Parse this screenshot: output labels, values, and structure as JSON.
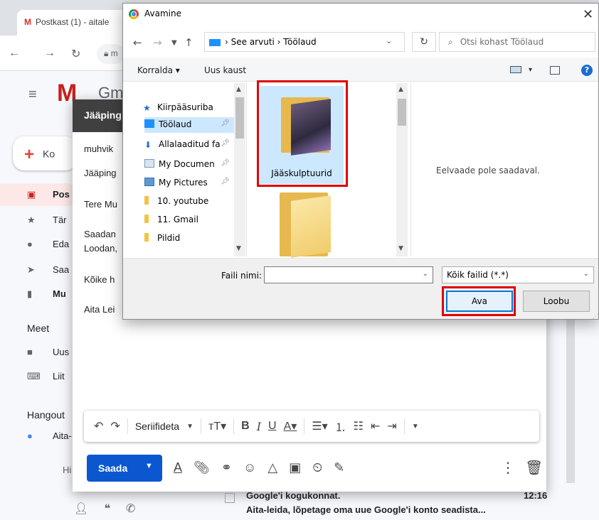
{
  "browser": {
    "tab_title": "Postkast (1) - aitale",
    "address_fragment": "m"
  },
  "gmail": {
    "logo_letters": "Gm",
    "compose_button": "Ko",
    "nav": [
      {
        "label": "Pos",
        "icon": "inbox-icon"
      },
      {
        "label": "Tär",
        "icon": "star-icon"
      },
      {
        "label": "Eda",
        "icon": "clock-icon"
      },
      {
        "label": "Saa",
        "icon": "send-icon"
      },
      {
        "label": "Mu",
        "icon": "draft-icon"
      }
    ],
    "meet_title": "Meet",
    "meet_items": [
      "Uus",
      "Liit"
    ],
    "hangouts_title": "Hangout",
    "hangouts_user": "Aita-",
    "hangouts_hint": "Hi",
    "bg_email": {
      "sender": "Google'i kogukonnat.",
      "subject": "Aita-leida, lõpetage oma uue Google'i konto seadista...",
      "time": "12:16"
    }
  },
  "compose": {
    "header": "Jääping",
    "to": "muhvik",
    "subject": "Jääping",
    "body_lines": [
      "Tere Mu",
      "Saadan",
      "Loodan,",
      "Kõike h",
      "Aita Lei"
    ],
    "font_name": "Seriifideta",
    "send_label": "Saada"
  },
  "dialog": {
    "title": "Avamine",
    "breadcrumb": [
      "See arvuti",
      "Töölaud"
    ],
    "search_placeholder": "Otsi kohast Töölaud",
    "organize": "Korralda",
    "new_folder": "Uus kaust",
    "tree": [
      {
        "label": "Kiirpääsuriba",
        "icon": "star-icon",
        "pinned": false
      },
      {
        "label": "Töölaud",
        "icon": "desktop-icon",
        "pinned": true,
        "selected": true
      },
      {
        "label": "Allalaaditud fa",
        "icon": "download-icon",
        "pinned": true
      },
      {
        "label": "My Documen",
        "icon": "documents-icon",
        "pinned": true
      },
      {
        "label": "My Pictures",
        "icon": "pictures-icon",
        "pinned": true
      },
      {
        "label": "10. youtube",
        "icon": "folder-icon",
        "pinned": false
      },
      {
        "label": "11. Gmail",
        "icon": "folder-icon",
        "pinned": false
      },
      {
        "label": "Pildid",
        "icon": "folder-icon",
        "pinned": false
      }
    ],
    "selected_folder": "Jääskulptuurid",
    "preview_text": "Eelvaade pole saadaval.",
    "filename_label": "Faili nimi:",
    "filename_value": "",
    "filetype": "Kõik failid (*.*)",
    "open_button": "Ava",
    "cancel_button": "Loobu"
  },
  "colors": {
    "send_blue": "#0b57d0",
    "highlight_red": "#e00000",
    "selection_blue": "#cce8ff",
    "compose_header": "#404040"
  }
}
